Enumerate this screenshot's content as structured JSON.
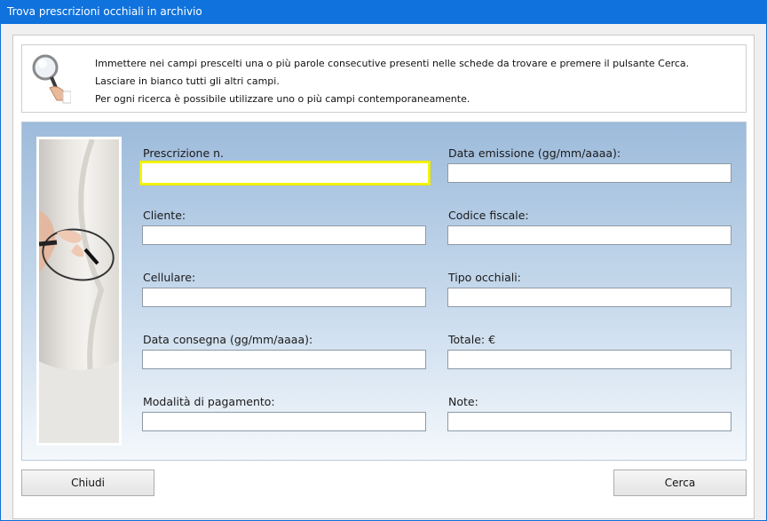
{
  "window": {
    "title": "Trova prescrizioni occhiali in archivio"
  },
  "info": {
    "lines": [
      "Immettere nei campi prescelti una o più parole consecutive presenti nelle schede da trovare e premere il pulsante Cerca.",
      "Lasciare in bianco tutti gli altri campi.",
      "Per ogni ricerca è possibile utilizzare uno o più campi contemporaneamente."
    ]
  },
  "form": {
    "fields": [
      {
        "label": "Prescrizione n.",
        "value": ""
      },
      {
        "label": "Data emissione (gg/mm/aaaa):",
        "value": ""
      },
      {
        "label": "Cliente:",
        "value": ""
      },
      {
        "label": "Codice fiscale:",
        "value": ""
      },
      {
        "label": "Cellulare:",
        "value": ""
      },
      {
        "label": "Tipo occhiali:",
        "value": ""
      },
      {
        "label": "Data consegna (gg/mm/aaaa):",
        "value": ""
      },
      {
        "label": "Totale: €",
        "value": ""
      },
      {
        "label": "Modalità di pagamento:",
        "value": ""
      },
      {
        "label": "Note:",
        "value": ""
      }
    ]
  },
  "buttons": {
    "close": "Chiudi",
    "search": "Cerca"
  },
  "colors": {
    "titlebar": "#0f72dd",
    "focus_border": "#f5f500",
    "panel_top": "#9dbbdb"
  }
}
